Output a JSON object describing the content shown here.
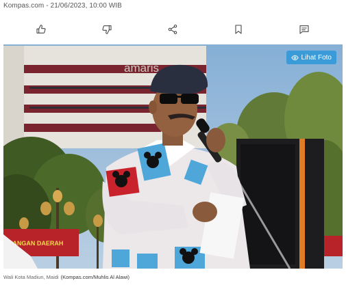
{
  "article": {
    "meta": "Kompas.com - 21/06/2023, 10:00 WIB"
  },
  "actions": [
    {
      "icon": "thumbs-up-icon",
      "label": "like"
    },
    {
      "icon": "thumbs-down-icon",
      "label": "dislike"
    },
    {
      "icon": "share-icon",
      "label": "share"
    },
    {
      "icon": "bookmark-icon",
      "label": "bookmark"
    },
    {
      "icon": "comment-icon",
      "label": "comment"
    }
  ],
  "photo": {
    "button_label": "Lihat Foto",
    "building_sign": "amaris",
    "banner_text": "PANGAN DAERAH",
    "caption": "Wali Kota Madiun, Maidi",
    "credit": "(Kompas.com/Muhlis Al Alawi)"
  },
  "colors": {
    "accent": "#3a9bd8",
    "sky": "#7ea7cf",
    "building": "#e6e2dc",
    "building_band": "#7a2430"
  }
}
